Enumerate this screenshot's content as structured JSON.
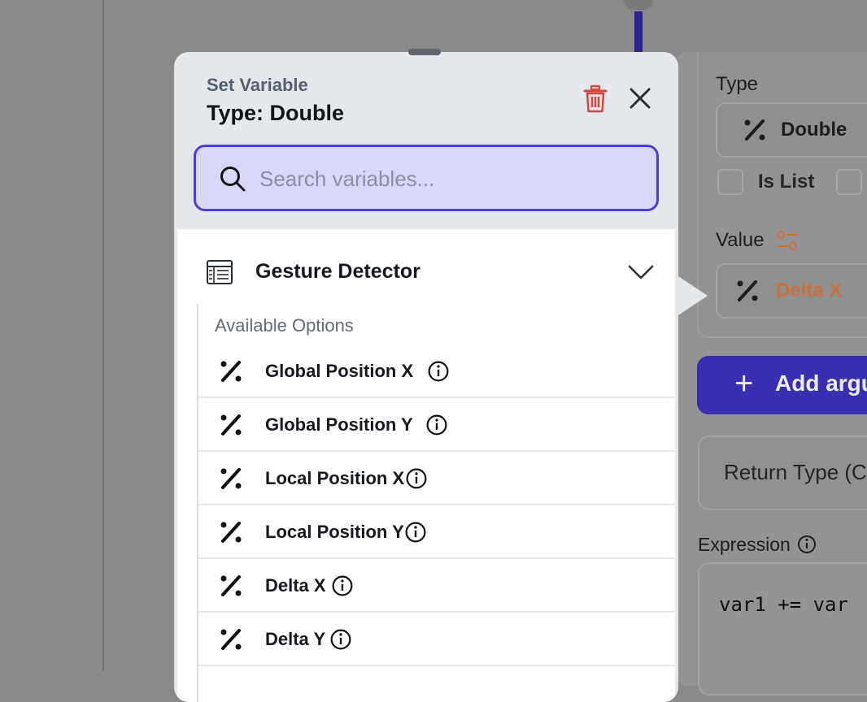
{
  "popup": {
    "subtitle": "Set Variable",
    "title": "Type: Double",
    "search": {
      "placeholder": "Search variables..."
    },
    "group": {
      "title": "Gesture Detector",
      "section_label": "Available Options"
    },
    "items": [
      {
        "label": "Global Position X"
      },
      {
        "label": "Global Position Y"
      },
      {
        "label": "Local Position X"
      },
      {
        "label": "Local Position Y"
      },
      {
        "label": "Delta X"
      },
      {
        "label": "Delta Y"
      }
    ],
    "icons": {
      "trash": "trash-icon",
      "close": "close-icon",
      "search": "search-icon",
      "table": "table-icon",
      "chevron": "chevron-down-icon",
      "type": "percent-icon",
      "info": "info-icon"
    }
  },
  "side_panel": {
    "type_label": "Type",
    "type_value": "Double",
    "is_list_label": "Is List",
    "value_label": "Value",
    "value_value": "Delta X",
    "add_button_label": "Add argu",
    "return_type_label": "Return Type (C",
    "expression_label": "Expression",
    "expression_code": "var1 += var"
  },
  "colors": {
    "accent": "#4b3fd6",
    "value_orange": "#c8703c",
    "danger": "#d04b3f",
    "add_button": "#3a2fb2"
  }
}
